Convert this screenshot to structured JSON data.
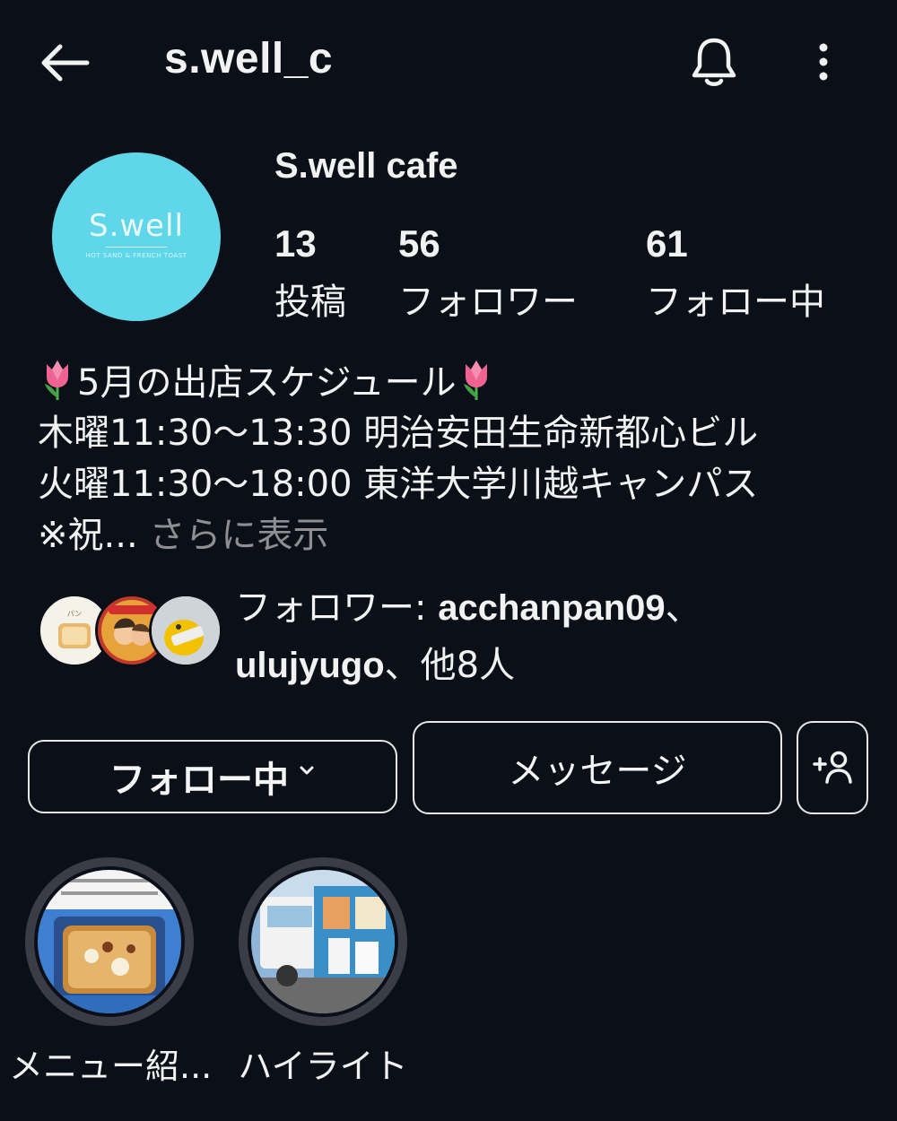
{
  "header": {
    "back_icon": "arrow-left-icon",
    "username": "s.well_c",
    "bell_icon": "bell-icon",
    "menu_icon": "more-vertical-icon"
  },
  "profile": {
    "avatar_text": "S.well",
    "avatar_subtext": "HOT SAND & FRENCH TOAST",
    "avatar_color": "#5fd6ea",
    "display_name": "S.well cafe",
    "stats": [
      {
        "value": "13",
        "label": "投稿"
      },
      {
        "value": "56",
        "label": "フォロワー"
      },
      {
        "value": "61",
        "label": "フォロー中"
      }
    ]
  },
  "bio": {
    "line1": "5月の出店スケジュール",
    "line2": "木曜11:30〜13:30 明治安田生命新都心ビル",
    "line3": "火曜11:30〜18:00 東洋大学川越キャンパス",
    "line4_prefix": "※祝...",
    "more_label": "さらに表示"
  },
  "mutual": {
    "prefix": "フォロワー: ",
    "user1": "acchanpan09",
    "sep": "、",
    "user2": "ulujyugo",
    "suffix": "、他8人"
  },
  "actions": {
    "following_label": "フォロー中",
    "message_label": "メッセージ",
    "add_person_icon": "add-person-icon"
  },
  "highlights": [
    {
      "label": "メニュー紹..."
    },
    {
      "label": "ハイライト"
    }
  ]
}
